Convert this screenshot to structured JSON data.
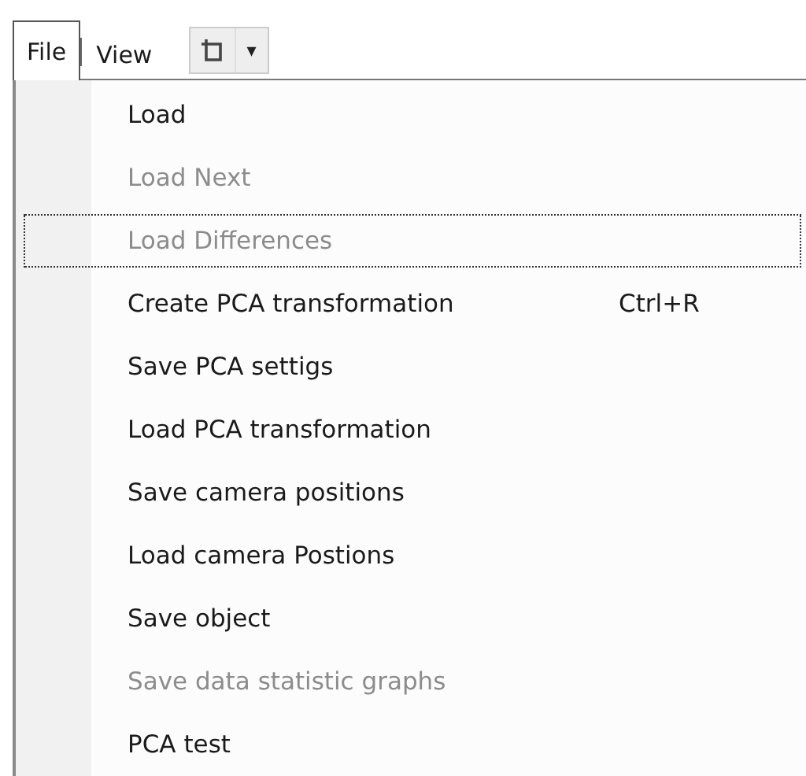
{
  "menu_bar": [
    {
      "label": "File",
      "selected": true
    },
    {
      "label": "View",
      "selected": false
    }
  ],
  "toolbar_dropdown": {
    "caret": "▾"
  },
  "file_menu": {
    "items": [
      {
        "label": "Load",
        "disabled": false,
        "focused": false
      },
      {
        "label": "Load Next",
        "disabled": true,
        "focused": false
      },
      {
        "label": "Load Differences",
        "disabled": true,
        "focused": true
      },
      {
        "label": "Create PCA transformation",
        "shortcut": "Ctrl+R",
        "disabled": false,
        "focused": false
      },
      {
        "label": "Save PCA settigs",
        "disabled": false,
        "focused": false
      },
      {
        "label": "Load PCA transformation",
        "disabled": false,
        "focused": false
      },
      {
        "label": "Save camera positions",
        "disabled": false,
        "focused": false
      },
      {
        "label": "Load camera Postions",
        "disabled": false,
        "focused": false
      },
      {
        "label": "Save object",
        "disabled": false,
        "focused": false
      },
      {
        "label": "Save data statistic graphs",
        "disabled": true,
        "focused": false
      },
      {
        "label": "PCA test",
        "disabled": false,
        "focused": false
      }
    ]
  }
}
